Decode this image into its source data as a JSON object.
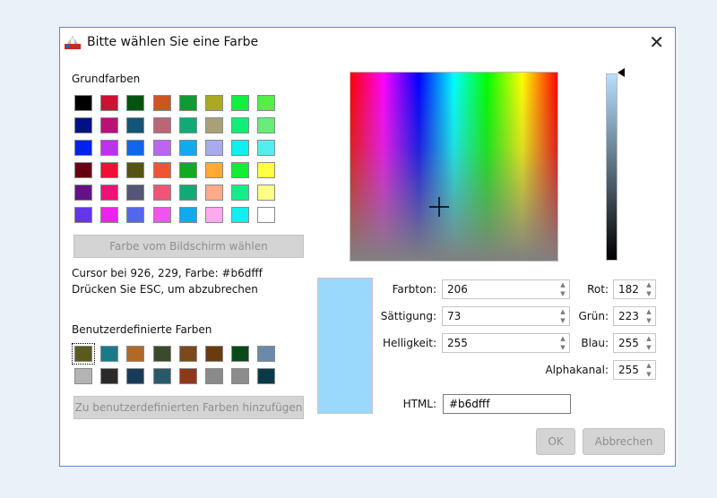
{
  "window": {
    "title": "Bitte wählen Sie eine Farbe",
    "close_glyph": "✕"
  },
  "basic_colors": {
    "label": "Grundfarben",
    "rows": [
      [
        "#000000",
        "#cc1133",
        "#005511",
        "#cc5522",
        "#119933",
        "#aaaa22",
        "#11ee44",
        "#55ee44"
      ],
      [
        "#001188",
        "#bb1177",
        "#115577",
        "#bb6677",
        "#11aa77",
        "#aaa077",
        "#11ee77",
        "#66ee77"
      ],
      [
        "#0022ee",
        "#bb33ee",
        "#1166ee",
        "#bb66ee",
        "#11aaee",
        "#aaaaee",
        "#11eeee",
        "#55eeee"
      ],
      [
        "#660011",
        "#ee1133",
        "#555511",
        "#ee5533",
        "#11aa22",
        "#ffaa33",
        "#11ee33",
        "#ffff44"
      ],
      [
        "#661188",
        "#ee1177",
        "#555577",
        "#ee5577",
        "#11aa77",
        "#ffaa88",
        "#11ee88",
        "#ffff88"
      ],
      [
        "#6633ee",
        "#ee22ee",
        "#5566ee",
        "#ee55ee",
        "#11aaee",
        "#ffaaee",
        "#11eeee",
        "#ffffff"
      ]
    ]
  },
  "pick_screen_button": "Farbe vom Bildschirm wählen",
  "cursor_info": {
    "line1": "Cursor bei 926, 229, Farbe: #b6dfff",
    "line2": "Drücken Sie ESC, um abzubrechen"
  },
  "custom_colors": {
    "label": "Benutzerdefinierte Farben",
    "rows": [
      [
        "#5a5a1e",
        "#1a7a8a",
        "#b06a28",
        "#3a4a2a",
        "#7a4a1a",
        "#6a3a10",
        "#0a4a1a",
        "#6a8aaa"
      ],
      [
        "#b4b4b4",
        "#2a2a2a",
        "#1a3a5a",
        "#2a5a6a",
        "#8a3a1a",
        "#8a8a8a",
        "#8c8c8c",
        "#0a3a4a"
      ]
    ]
  },
  "add_custom_button": "Zu benutzerdefinierten Farben hinzufügen",
  "preview_color": "#9ad9fb",
  "fields": {
    "hue": {
      "label": "Farbton:",
      "value": "206"
    },
    "saturation": {
      "label": "Sättigung:",
      "value": "73"
    },
    "value": {
      "label": "Helligkeit:",
      "value": "255"
    },
    "red": {
      "label": "Rot:",
      "value": "182"
    },
    "green": {
      "label": "Grün:",
      "value": "223"
    },
    "blue": {
      "label": "Blau:",
      "value": "255"
    },
    "alpha": {
      "label": "Alphakanal:",
      "value": "255"
    },
    "html": {
      "label": "HTML:",
      "value": "#b6dfff"
    }
  },
  "buttons": {
    "ok": "OK",
    "cancel": "Abbrechen"
  }
}
